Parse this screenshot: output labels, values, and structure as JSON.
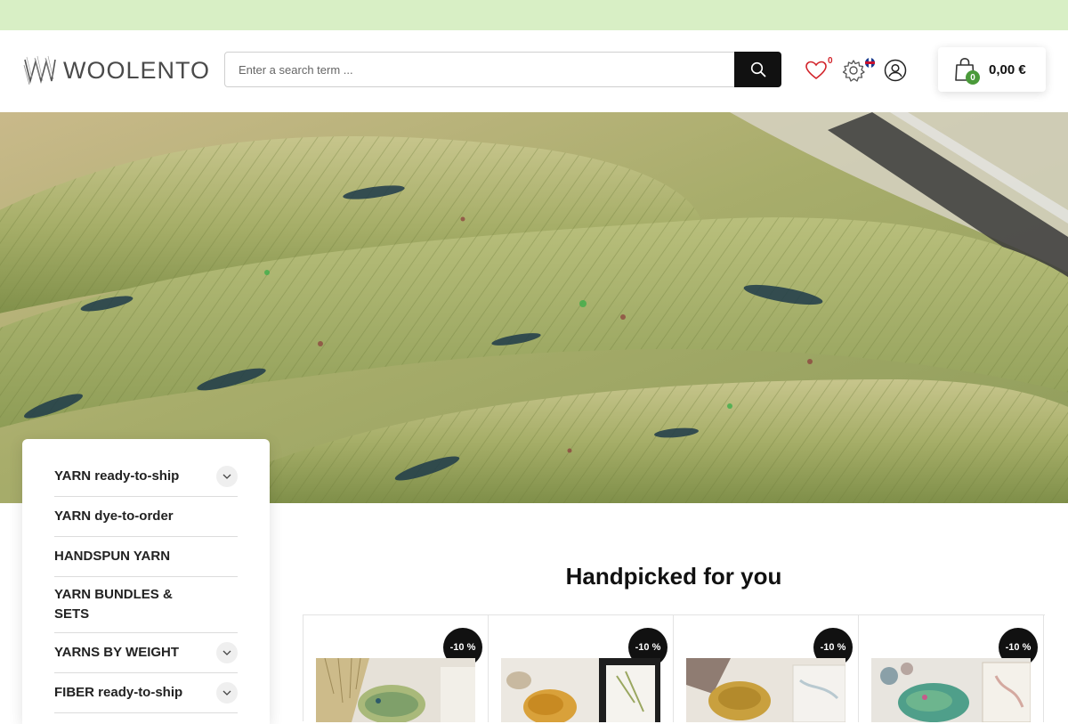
{
  "brand": {
    "name": "WOOLENTO"
  },
  "header": {
    "search_placeholder": "Enter a search term ...",
    "wishlist_count": "0",
    "cart_count": "0",
    "cart_total": "0,00 €"
  },
  "sidebar": {
    "items": [
      {
        "label": "YARN ready-to-ship",
        "expandable": true
      },
      {
        "label": "YARN dye-to-order",
        "expandable": false
      },
      {
        "label": "HANDSPUN YARN",
        "expandable": false
      },
      {
        "label": "YARN BUNDLES & SETS",
        "expandable": false
      },
      {
        "label": "YARNS BY WEIGHT",
        "expandable": true
      },
      {
        "label": "FIBER ready-to-ship",
        "expandable": true
      }
    ]
  },
  "main": {
    "section_title": "Handpicked for you",
    "products": [
      {
        "badge": "-10 %"
      },
      {
        "badge": "-10 %"
      },
      {
        "badge": "-10 %"
      },
      {
        "badge": "-10 %"
      }
    ]
  },
  "colors": {
    "top_bar": "#d8efc5",
    "accent_green": "#4a9a3a",
    "dark": "#111111",
    "wishlist_count": "#d2232a"
  },
  "icons": [
    "heart-icon",
    "gear-icon",
    "flag-icon",
    "user-icon",
    "cart-icon",
    "search-icon",
    "chevron-down-icon"
  ]
}
